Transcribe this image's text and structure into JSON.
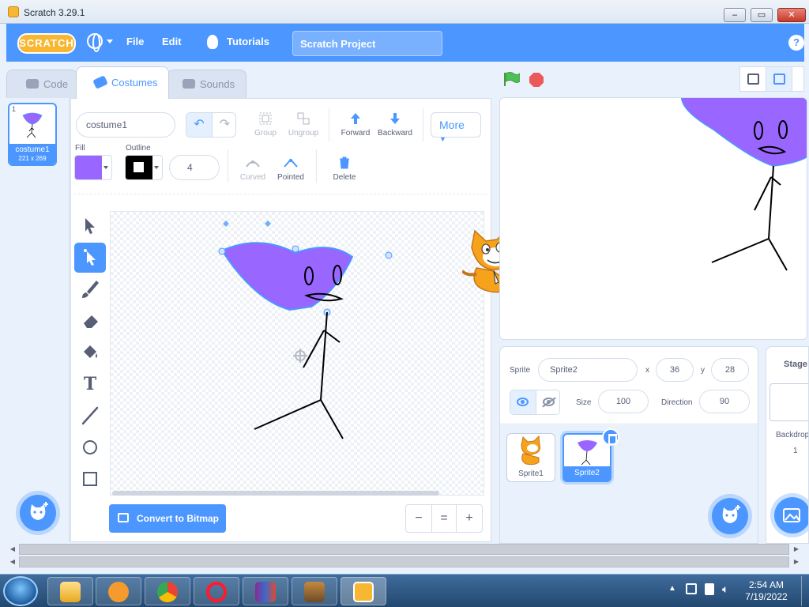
{
  "window": {
    "title": "Scratch 3.29.1",
    "minimize_label": "‒",
    "maximize_label": "▭",
    "close_label": "✕"
  },
  "menubar": {
    "logo": "SCRATCH",
    "file": "File",
    "edit": "Edit",
    "tutorials": "Tutorials",
    "project_title": "Scratch Project",
    "help": "?"
  },
  "tabs": {
    "code": "Code",
    "costumes": "Costumes",
    "sounds": "Sounds"
  },
  "costumes": [
    {
      "number": "1",
      "name": "costume1",
      "size": "221 x 269"
    }
  ],
  "paint": {
    "costume_name": "costume1",
    "group": "Group",
    "ungroup": "Ungroup",
    "forward": "Forward",
    "backward": "Backward",
    "more": "More",
    "fill_label": "Fill",
    "outline_label": "Outline",
    "outline_width": "4",
    "curved": "Curved",
    "pointed": "Pointed",
    "delete": "Delete",
    "convert": "Convert to Bitmap",
    "fill_color": "#9966ff",
    "outline_color": "#000000",
    "zoom_out": "−",
    "zoom_reset": "=",
    "zoom_in": "+"
  },
  "sprite_info": {
    "sprite_label": "Sprite",
    "sprite_name": "Sprite2",
    "x_label": "x",
    "x": "36",
    "y_label": "y",
    "y": "28",
    "size_label": "Size",
    "size": "100",
    "direction_label": "Direction",
    "direction": "90"
  },
  "sprites": [
    {
      "name": "Sprite1"
    },
    {
      "name": "Sprite2"
    }
  ],
  "stage_pane": {
    "header": "Stage",
    "backdrops_label": "Backdrops",
    "backdrops_count": "1"
  },
  "taskbar": {
    "time": "2:54 AM",
    "date": "7/19/2022"
  },
  "colors": {
    "accent": "#4c97ff",
    "sprite_purple": "#9966ff",
    "cat_orange": "#f7a21b",
    "stop_red": "#ec5959",
    "flag_green": "#4cbf56"
  }
}
